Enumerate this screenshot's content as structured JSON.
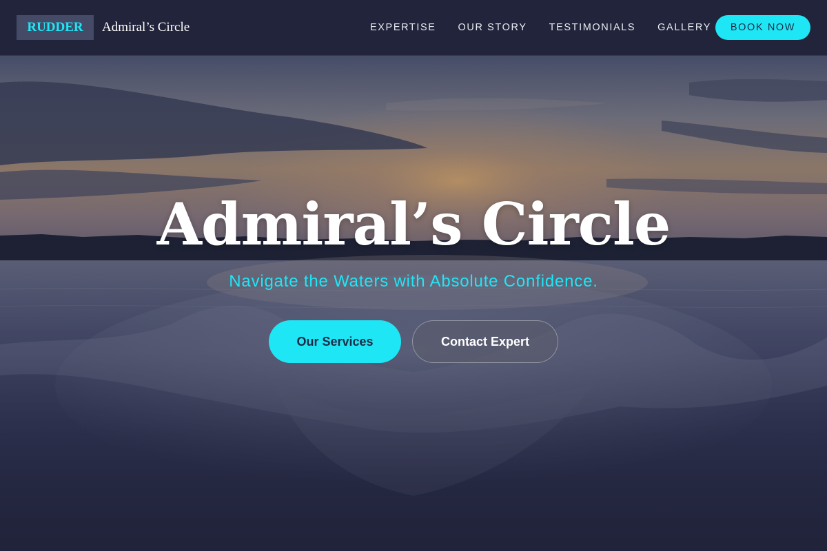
{
  "navbar": {
    "logo_text": "RUDDER",
    "brand_name": "Admiral’s Circle",
    "links": [
      {
        "label": "EXPERTISE"
      },
      {
        "label": "OUR STORY"
      },
      {
        "label": "TESTIMONIALS"
      },
      {
        "label": "GALLERY"
      }
    ],
    "cta_label": "BOOK NOW"
  },
  "hero": {
    "title": "Admiral’s Circle",
    "subtitle": "Navigate the Waters with Absolute Confidence.",
    "primary_button": "Our Services",
    "secondary_button": "Contact Expert",
    "background_image": "sunset-over-water-with-boat-wake"
  },
  "colors": {
    "accent": "#1fe6f5",
    "navbar_bg": "#22243c",
    "logo_box_bg": "#454a66",
    "text_primary": "#ffffff",
    "button_text_dark": "#1e2a45"
  }
}
